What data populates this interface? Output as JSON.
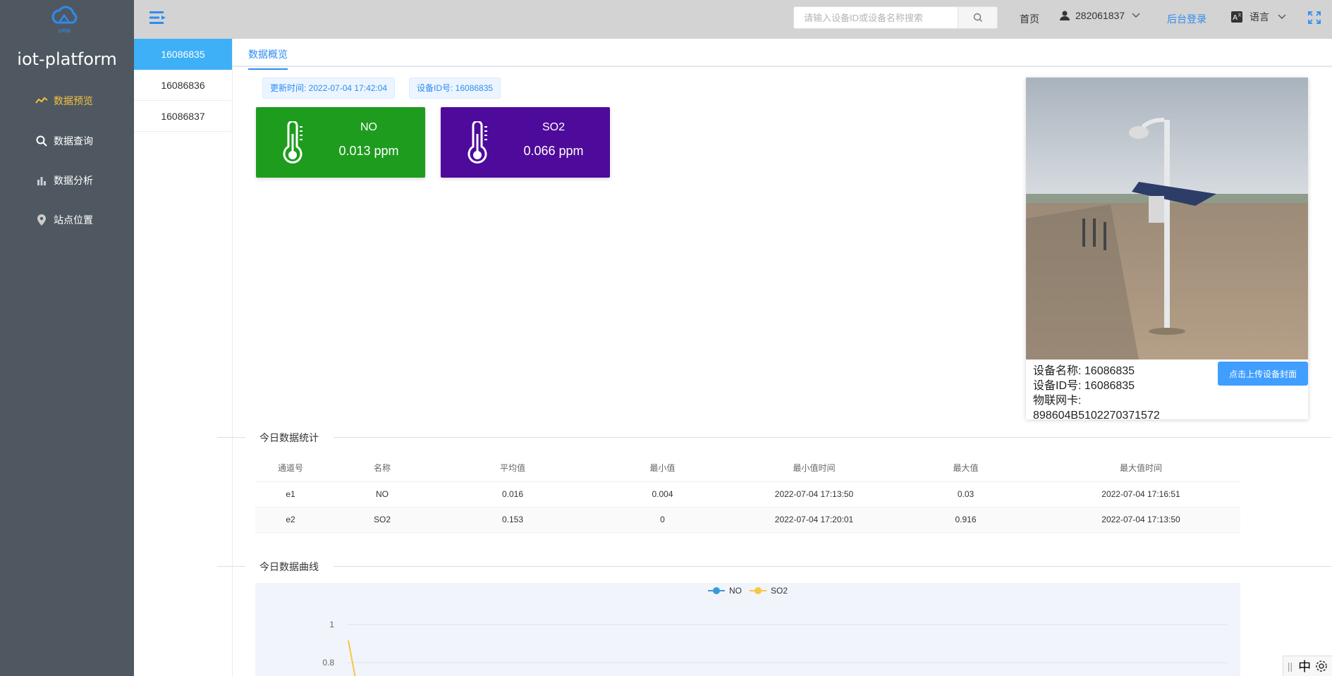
{
  "sidebar": {
    "logo_text": "云物联",
    "app_name": "iot-platform",
    "items": [
      {
        "label": "数据预览",
        "icon": "line-chart-icon"
      },
      {
        "label": "数据查询",
        "icon": "search-icon"
      },
      {
        "label": "数据分析",
        "icon": "bar-chart-icon"
      },
      {
        "label": "站点位置",
        "icon": "location-pin-icon"
      }
    ],
    "active_color": "#f3c23e"
  },
  "header": {
    "search_placeholder": "请输入设备ID或设备名称搜索",
    "search_value": "",
    "home_label": "首页",
    "user_name": "282061837",
    "admin_login_label": "后台登录",
    "language_label": "语言"
  },
  "devices": [
    "16086835",
    "16086836",
    "16086837"
  ],
  "tabs": {
    "overview": "数据概览"
  },
  "tags": {
    "update_time": "更新时间: 2022-07-04 17:42:04",
    "device_id": "设备ID号: 16086835"
  },
  "metrics": [
    {
      "name": "NO",
      "value": "0.013 ppm",
      "color": "#1e9c1e"
    },
    {
      "name": "SO2",
      "value": "0.066 ppm",
      "color": "#4e0a9a"
    }
  ],
  "device_card": {
    "name_line": "设备名称: 16086835",
    "id_line": "设备ID号: 16086835",
    "card_label": "物联网卡:",
    "card_no": "898604B5102270371572",
    "upload_label": "点击上传设备封面"
  },
  "sections": {
    "stats_title": "今日数据统计",
    "curve_title": "今日数据曲线"
  },
  "stats_table": {
    "headers": [
      "通道号",
      "名称",
      "平均值",
      "最小值",
      "最小值时间",
      "最大值",
      "最大值时间"
    ],
    "rows": [
      [
        "e1",
        "NO",
        "0.016",
        "0.004",
        "2022-07-04 17:13:50",
        "0.03",
        "2022-07-04 17:16:51"
      ],
      [
        "e2",
        "SO2",
        "0.153",
        "0",
        "2022-07-04 17:20:01",
        "0.916",
        "2022-07-04 17:13:50"
      ]
    ]
  },
  "chart_data": {
    "type": "line",
    "series": [
      {
        "name": "NO",
        "color": "#3a9ad9",
        "values": []
      },
      {
        "name": "SO2",
        "color": "#f5c742",
        "values": [
          0.916
        ]
      }
    ],
    "y_ticks": [
      "1",
      "0.8"
    ],
    "ylim": [
      0,
      1
    ],
    "legend": "top-center",
    "grid": true
  },
  "ime": {
    "label": "中"
  }
}
